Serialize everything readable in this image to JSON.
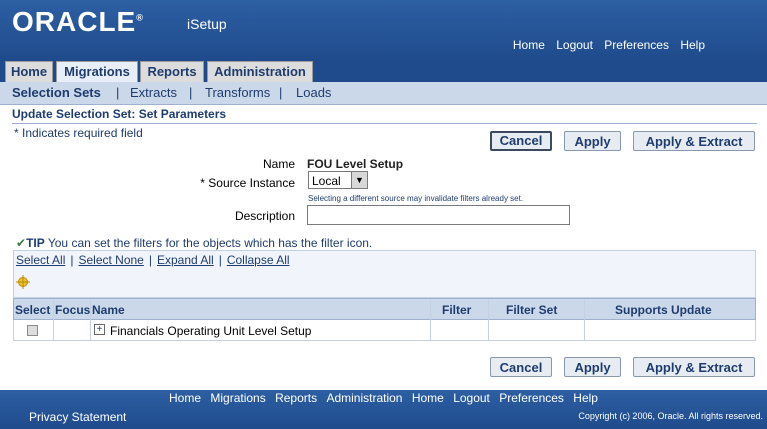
{
  "header": {
    "logo": "ORACLE",
    "app_name": "iSetup",
    "links": [
      "Home",
      "Logout",
      "Preferences",
      "Help"
    ]
  },
  "tabs": [
    {
      "label": "Home",
      "active": false
    },
    {
      "label": "Migrations",
      "active": true
    },
    {
      "label": "Reports",
      "active": false
    },
    {
      "label": "Administration",
      "active": false
    }
  ],
  "subnav": {
    "items": [
      "Selection Sets",
      "Extracts",
      "Transforms",
      "Loads"
    ],
    "active": "Selection Sets"
  },
  "page": {
    "title": "Update Selection Set: Set Parameters",
    "required_note": "* Indicates required field"
  },
  "buttons": {
    "cancel": "Cancel",
    "apply": "Apply",
    "apply_extract": "Apply & Extract"
  },
  "form": {
    "name_label": "Name",
    "name_value": "FOU Level Setup",
    "source_label": "* Source Instance",
    "source_value": "Local",
    "source_hint": "Selecting a different source may invalidate filters already set.",
    "description_label": "Description",
    "description_value": ""
  },
  "tip": {
    "prefix": "TIP",
    "text": "You can set the filters for the objects which has the filter icon."
  },
  "table": {
    "actions": [
      "Select All",
      "Select None",
      "Expand All",
      "Collapse All"
    ],
    "columns": [
      "Select",
      "Focus",
      "Name",
      "Filter",
      "Filter Set",
      "Supports Update"
    ],
    "rows": [
      {
        "name": "Financials Operating Unit Level Setup"
      }
    ]
  },
  "footer": {
    "links": [
      "Home",
      "Migrations",
      "Reports",
      "Administration",
      "Home",
      "Logout",
      "Preferences",
      "Help"
    ],
    "privacy": "Privacy Statement",
    "copyright": "Copyright (c) 2006, Oracle. All rights reserved."
  },
  "colors": {
    "brand_blue": "#1f4b8c",
    "label_blue": "#1f3c6e",
    "subnav_bg": "#cbd8ea"
  }
}
